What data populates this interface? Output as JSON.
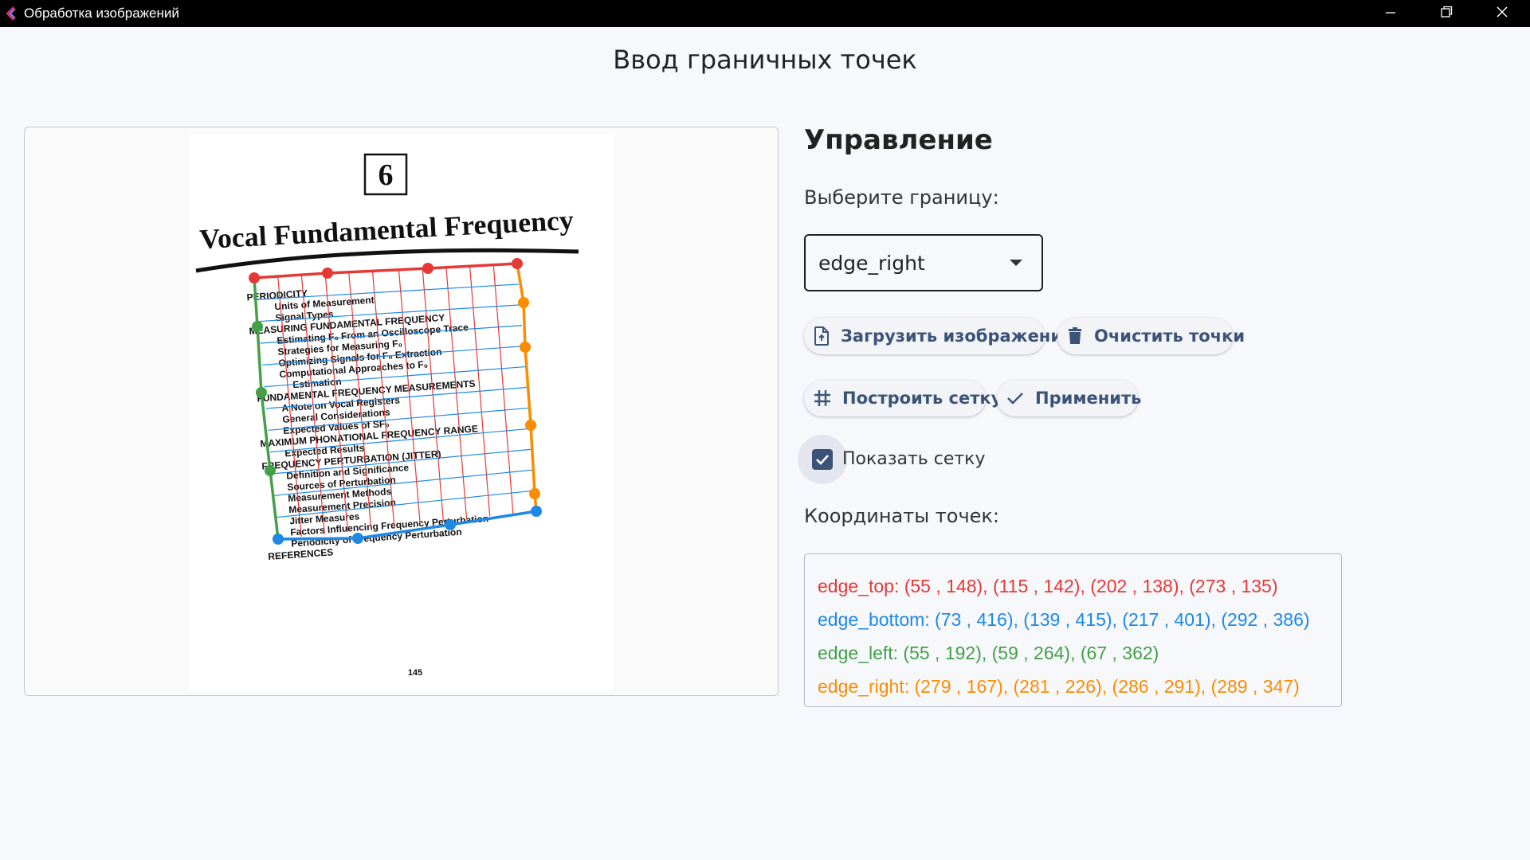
{
  "window": {
    "title": "Обработка изображений",
    "controls": {
      "minimize": "minimize-icon",
      "restore": "restore-icon",
      "close": "close-icon"
    }
  },
  "page": {
    "title": "Ввод граничных точек"
  },
  "document": {
    "page_number": "6",
    "heading": "Vocal Fundamental Frequency",
    "toc": [
      "PERIODICITY",
      "Units of Measurement",
      "Signal Types",
      "MEASURING FUNDAMENTAL FREQUENCY",
      "Estimating F₀ From an Oscilloscope Trace",
      "Strategies for Measuring F₀",
      "Optimizing Signals for F₀ Extraction",
      "Computational Approaches to F₀",
      "Estimation",
      "FUNDAMENTAL FREQUENCY MEASUREMENTS",
      "A Note on Vocal Registers",
      "General Considerations",
      "Expected Values of SF₀",
      "MAXIMUM PHONATIONAL FREQUENCY RANGE",
      "Expected Results",
      "FREQUENCY PERTURBATION (JITTER)",
      "Definition and Significance",
      "Sources of Perturbation",
      "Measurement Methods",
      "Measurement Precision",
      "Jitter Measures",
      "Factors Influencing Frequency Perturbation",
      "Periodicity of Frequency Perturbation",
      "REFERENCES"
    ],
    "footer_number": "145"
  },
  "controls": {
    "title": "Управление",
    "choose_label": "Выберите границу:",
    "select_value": "edge_right",
    "load_button": "Загрузить изображение",
    "clear_button": "Очистить точки",
    "grid_button": "Построить сетку",
    "apply_button": "Применить",
    "show_grid_label": "Показать сетку",
    "show_grid_checked": true,
    "coords_label": "Координаты точек:"
  },
  "coordinates": {
    "edge_top": "edge_top: (55 , 148), (115 , 142), (202 , 138), (273 , 135)",
    "edge_bottom": "edge_bottom: (73 , 416), (139 , 415), (217 , 401), (292 , 386)",
    "edge_left": "edge_left: (55 , 192), (59 , 264), (67 , 362)",
    "edge_right": "edge_right: (279 , 167), (281 , 226), (286 , 291), (289 , 347)"
  },
  "colors": {
    "edge_top": "#e53935",
    "edge_bottom": "#1e88e5",
    "edge_left": "#43a047",
    "edge_right": "#fb8c00",
    "accent": "#3b5377"
  }
}
